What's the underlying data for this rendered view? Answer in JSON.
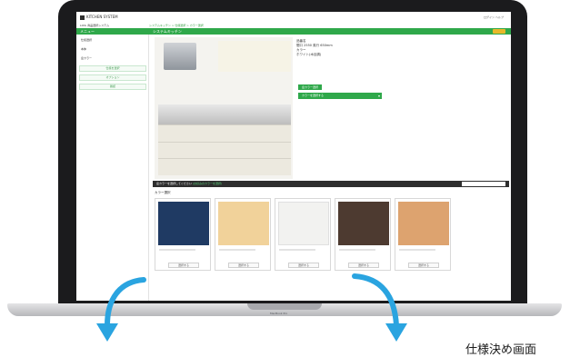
{
  "laptop": {
    "model_label": "MacBook Pro"
  },
  "app": {
    "logo_text": "KITCHEN SYSTEM",
    "header_links": "ログイン  ヘルプ",
    "subheader": "LIXIL 商品選択システム",
    "breadcrumb": "システムキッチン > 仕様選択 > カラー選択",
    "greenbar_left": "メニュー",
    "page_title": "システムキッチン"
  },
  "sidebar": {
    "items": [
      {
        "label": "仕様選択"
      },
      {
        "label": "本体"
      },
      {
        "label": "扉カラー"
      }
    ],
    "boxes": [
      {
        "label": "仕様を選択"
      },
      {
        "label": "オプション"
      },
      {
        "label": "確認"
      }
    ]
  },
  "product": {
    "info_lines": [
      "品番名",
      "間口 2550 奥行 650mm",
      "カラー",
      "ホワイト(木目調)"
    ],
    "tag_label": "扉カラー選択",
    "select_value": "カラーを選択する"
  },
  "color_section": {
    "bar_text": "扉カラーを選択してください",
    "bar_highlight": "(お好みのカラーを選択)",
    "heading": "カラー選択",
    "swatches": [
      {
        "color": "#1f3a63",
        "button_label": "選択する"
      },
      {
        "color": "#f1d29a",
        "button_label": "選択する"
      },
      {
        "color": "#f2f2f0",
        "button_label": "選択する"
      },
      {
        "color": "#4d3a30",
        "button_label": "選択する"
      },
      {
        "color": "#dda36f",
        "button_label": "選択する"
      }
    ]
  },
  "annotation": {
    "caption": "仕様決め画面",
    "arrow_color": "#2aa4e0"
  }
}
